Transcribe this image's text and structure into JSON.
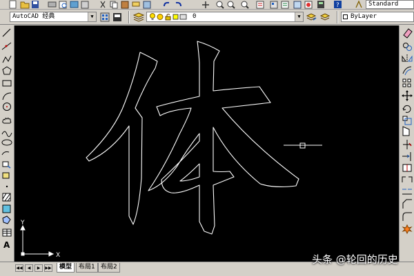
{
  "toolbar": {
    "workspace_value": "AutoCAD 经典",
    "layer_value": "0",
    "layer_color": "#ffff00",
    "linetype_value": "ByLayer",
    "textstyle_value": "Standard"
  },
  "left_tools": [
    "line-icon",
    "construction-line-icon",
    "polyline-icon",
    "polygon-icon",
    "rectangle-icon",
    "arc-icon",
    "circle-icon",
    "revision-cloud-icon",
    "spline-icon",
    "ellipse-icon",
    "ellipse-arc-icon",
    "insert-block-icon",
    "make-block-icon",
    "point-icon",
    "hatch-icon",
    "gradient-icon",
    "region-icon",
    "table-icon",
    "multiline-text-icon"
  ],
  "right_tools": [
    "erase-icon",
    "copy-icon",
    "mirror-icon",
    "offset-icon",
    "array-icon",
    "move-icon",
    "rotate-icon",
    "scale-icon",
    "stretch-icon",
    "trim-icon",
    "extend-icon",
    "break-at-point-icon",
    "break-icon",
    "join-icon",
    "chamfer-icon",
    "fillet-icon",
    "explode-icon"
  ],
  "canvas": {
    "background": "#000000",
    "glyph": "体",
    "ucs_y_label": "Y",
    "ucs_x_label": "X"
  },
  "tabs": {
    "nav_buttons": [
      "◀◀",
      "◀",
      "▶",
      "▶▶"
    ],
    "items": [
      {
        "label": "模型",
        "active": true
      },
      {
        "label": "布局1",
        "active": false
      },
      {
        "label": "布局2",
        "active": false
      }
    ]
  },
  "watermark": {
    "text": "头条 @轮回的历史"
  }
}
